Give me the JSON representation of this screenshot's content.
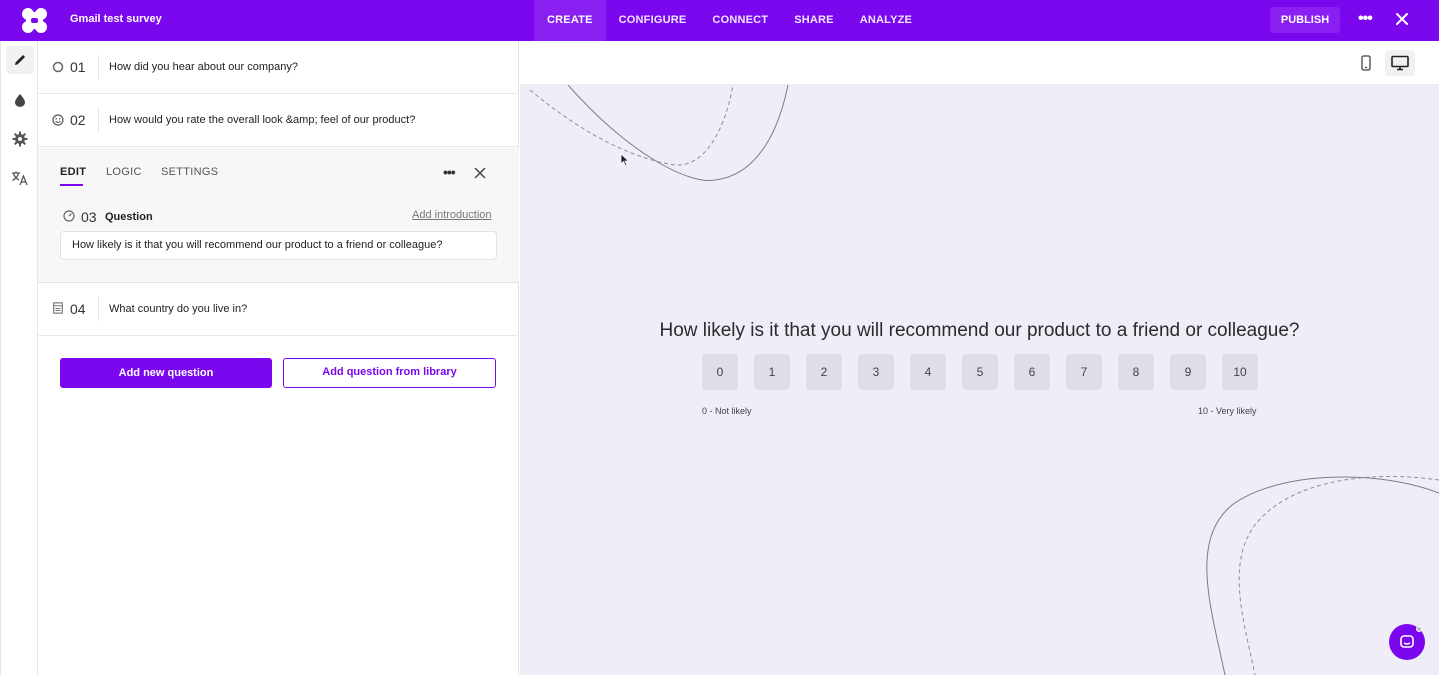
{
  "app": {
    "survey_title": "Gmail test survey",
    "nav": [
      "CREATE",
      "CONFIGURE",
      "CONNECT",
      "SHARE",
      "ANALYZE"
    ],
    "active_nav": "CREATE",
    "publish_label": "PUBLISH",
    "accent_color": "#7b07ee"
  },
  "rail": {
    "icons": [
      "pencil-icon",
      "drop-icon",
      "gear-icon",
      "translate-icon"
    ]
  },
  "questions": [
    {
      "num": "01",
      "text": "How did you hear about our company?",
      "icon": "radio-icon"
    },
    {
      "num": "02",
      "text": "How would you rate the overall look &amp; feel of our product?",
      "icon": "smiley-icon"
    },
    {
      "num": "04",
      "text": "What country do you live in?",
      "icon": "dropdown-list-icon"
    }
  ],
  "editor": {
    "tabs": [
      "EDIT",
      "LOGIC",
      "SETTINGS"
    ],
    "active_tab": "EDIT",
    "question_num": "03",
    "question_label": "Question",
    "add_intro": "Add introduction",
    "question_text": "How likely is it that you will recommend our product to a friend or colleague?"
  },
  "actions": {
    "add_new": "Add new question",
    "add_library": "Add question from library"
  },
  "preview": {
    "question": "How likely is it that you will recommend our product to a friend or colleague?",
    "scale": [
      "0",
      "1",
      "2",
      "3",
      "4",
      "5",
      "6",
      "7",
      "8",
      "9",
      "10"
    ],
    "min_label": "0 - Not likely",
    "max_label": "10 - Very likely",
    "device": "desktop"
  }
}
